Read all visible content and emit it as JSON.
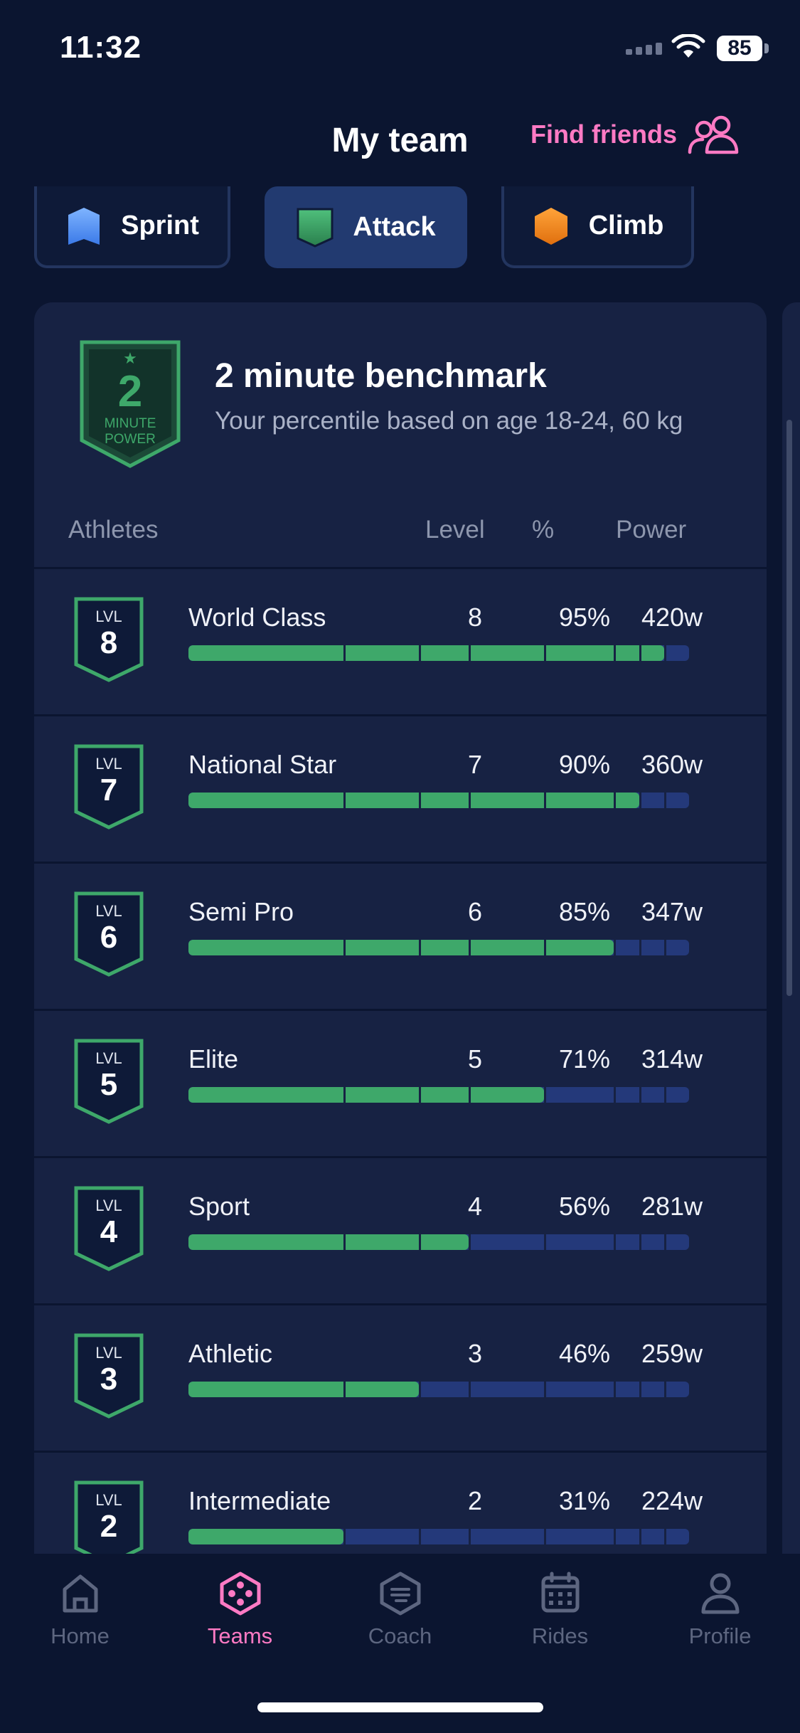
{
  "status_bar": {
    "time": "11:32",
    "battery": "85"
  },
  "header": {
    "title": "My team",
    "find_friends": "Find friends"
  },
  "tabs": [
    {
      "label": "Sprint",
      "color": "#4a8ff2"
    },
    {
      "label": "Attack",
      "color": "#3ea86a",
      "active": true
    },
    {
      "label": "Climb",
      "color": "#f28a1e"
    }
  ],
  "benchmark": {
    "badge_number": "2",
    "badge_line1": "MINUTE",
    "badge_line2": "POWER",
    "title": "2 minute benchmark",
    "subtitle": " Your percentile based on age 18-24, 60 kg"
  },
  "table": {
    "col_athletes": "Athletes",
    "col_level": "Level",
    "col_pct": "%",
    "col_power": "Power",
    "badge_prefix": "LVL",
    "rows": [
      {
        "badge": "8",
        "name": "World Class",
        "level": "8",
        "pct": "95%",
        "power": "420w",
        "fill": 0.95
      },
      {
        "badge": "7",
        "name": "National Star",
        "level": "7",
        "pct": "90%",
        "power": "360w",
        "fill": 0.9
      },
      {
        "badge": "6",
        "name": "Semi Pro",
        "level": "6",
        "pct": "85%",
        "power": "347w",
        "fill": 0.85
      },
      {
        "badge": "5",
        "name": "Elite",
        "level": "5",
        "pct": "71%",
        "power": "314w",
        "fill": 0.71
      },
      {
        "badge": "4",
        "name": "Sport",
        "level": "4",
        "pct": "56%",
        "power": "281w",
        "fill": 0.56
      },
      {
        "badge": "3",
        "name": "Athletic",
        "level": "3",
        "pct": "46%",
        "power": "259w",
        "fill": 0.46
      },
      {
        "badge": "2",
        "name": "Intermediate",
        "level": "2",
        "pct": "31%",
        "power": "224w",
        "fill": 0.31
      }
    ]
  },
  "nav": [
    {
      "label": "Home",
      "icon": "home-icon"
    },
    {
      "label": "Teams",
      "icon": "teams-icon",
      "active": true
    },
    {
      "label": "Coach",
      "icon": "coach-icon"
    },
    {
      "label": "Rides",
      "icon": "calendar-icon"
    },
    {
      "label": "Profile",
      "icon": "profile-icon"
    }
  ],
  "colors": {
    "accent": "#ff7ac4",
    "bar_fill": "#3ea86a",
    "bar_track": "#24397a",
    "card": "#172243",
    "background": "#0b1530"
  }
}
